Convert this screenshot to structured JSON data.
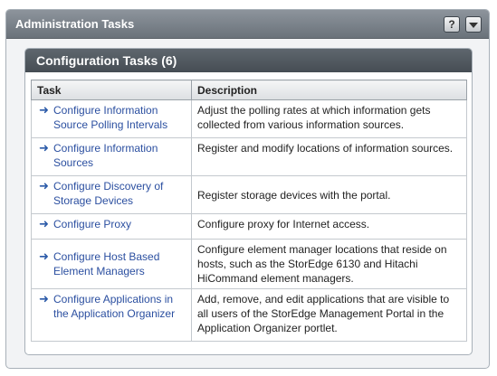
{
  "portlet": {
    "title": "Administration Tasks",
    "help_label": "?",
    "menu_icon": "chevron-down-icon"
  },
  "panel": {
    "title": "Configuration Tasks (6)"
  },
  "table": {
    "headers": [
      "Task",
      "Description"
    ],
    "rows": [
      {
        "task": "Configure Information Source Polling Intervals",
        "description": "Adjust the polling rates at which information gets collected from various information sources."
      },
      {
        "task": "Configure Information Sources",
        "description": "Register and modify locations of information sources."
      },
      {
        "task": "Configure Discovery of Storage Devices",
        "description": "Register storage devices with the portal."
      },
      {
        "task": "Configure Proxy",
        "description": "Configure proxy for Internet access."
      },
      {
        "task": "Configure Host Based Element Managers",
        "description": "Configure element manager locations that reside on hosts, such as the StorEdge 6130 and Hitachi HiCommand element managers."
      },
      {
        "task": "Configure Applications in the Application Organizer",
        "description": "Add, remove, and edit applications that are visible to all users of the StorEdge Management Portal in the Application Organizer portlet."
      }
    ]
  }
}
